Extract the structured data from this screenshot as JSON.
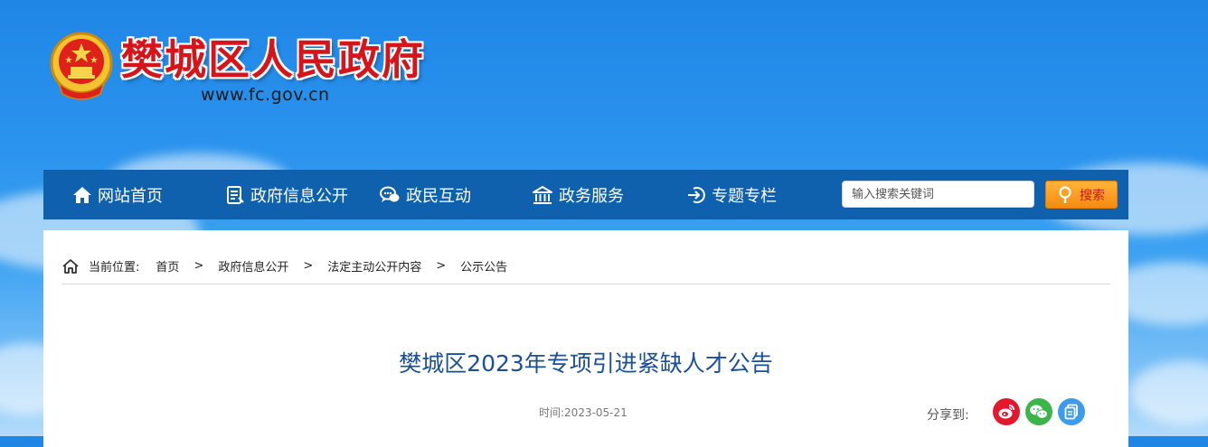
{
  "header": {
    "site_title": "樊城区人民政府",
    "site_url": "www.fc.gov.cn"
  },
  "nav": {
    "items": [
      {
        "label": "网站首页",
        "icon": "home-icon"
      },
      {
        "label": "政府信息公开",
        "icon": "document-icon"
      },
      {
        "label": "政民互动",
        "icon": "chat-icon"
      },
      {
        "label": "政务服务",
        "icon": "building-icon"
      },
      {
        "label": "专题专栏",
        "icon": "login-arrow-icon"
      }
    ],
    "search_placeholder": "输入搜索关键词",
    "search_button": "搜索"
  },
  "breadcrumb": {
    "prefix": "当前位置:",
    "items": [
      "首页",
      "政府信息公开",
      "法定主动公开内容",
      "公示公告"
    ],
    "separator": ">"
  },
  "article": {
    "title": "樊城区2023年专项引进紧缺人才公告",
    "time": "时间:2023-05-21",
    "share_label": "分享到:",
    "share_icons": [
      "weibo-icon",
      "wechat-icon",
      "copy-icon"
    ]
  },
  "colors": {
    "nav_bg": "#0f61ad",
    "title_red": "#d8141b",
    "article_title": "#1a4f99",
    "weibo": "#e6162d",
    "wechat": "#3bb54a",
    "copy": "#3d9be9"
  }
}
